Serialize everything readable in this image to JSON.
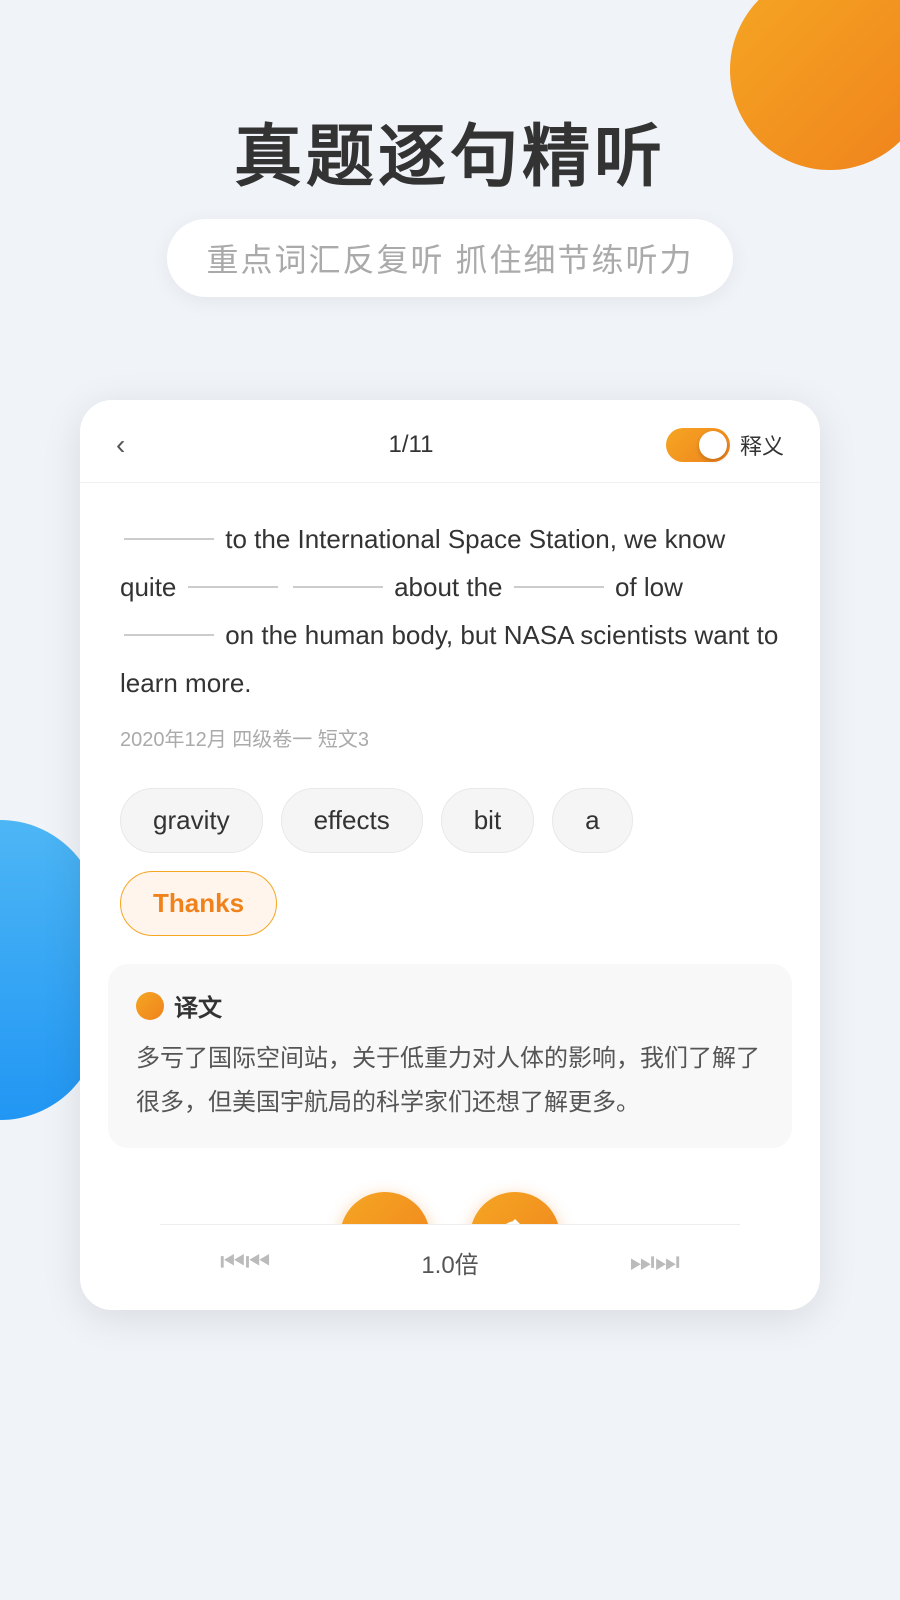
{
  "background": {
    "orange_circle": true,
    "blue_shape": true
  },
  "header": {
    "main_title": "真题逐句精听",
    "subtitle": "重点词汇反复听  抓住细节练听力"
  },
  "card": {
    "back_label": "‹",
    "page_indicator": "1/11",
    "toggle_label": "释义",
    "toggle_on": true,
    "fill_sentence": "________ to the International Space Station, we know quite ________ ________ about the ________ of low ________ on the human body, but NASA scientists want to learn more.",
    "source_tag": "2020年12月 四级卷一 短文3",
    "word_chips": [
      {
        "text": "gravity",
        "selected": false
      },
      {
        "text": "effects",
        "selected": false
      },
      {
        "text": "bit",
        "selected": false
      },
      {
        "text": "a",
        "selected": false
      },
      {
        "text": "Thanks",
        "selected": true
      }
    ],
    "translation": {
      "icon": "orange_dot",
      "title": "译文",
      "text": "多亏了国际空间站，关于低重力对人体的影响，我们了解了很多，但美国宇航局的科学家们还想了解更多。"
    },
    "controls": {
      "play_pause_label": "pause",
      "replay_label": "replay"
    }
  },
  "bottom_nav": {
    "prev_label": "⏮",
    "speed_label": "1.0倍",
    "next_label": "⏭"
  }
}
